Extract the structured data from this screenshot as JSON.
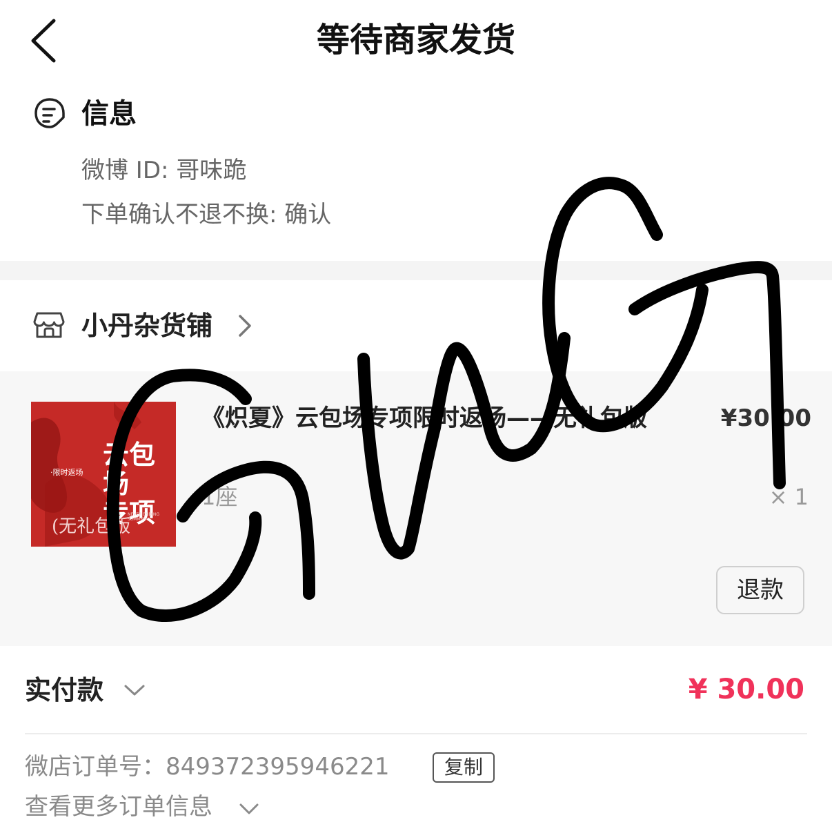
{
  "header": {
    "title": "等待商家发货",
    "back_icon": "chevron-left-icon"
  },
  "info_section": {
    "title": "信息",
    "icon": "message-note-icon",
    "weibo_id_line": "微博 ID: 哥味跪",
    "confirm_line": "下单确认不退不换: 确认"
  },
  "shop": {
    "name": "小丹杂货铺",
    "icon": "storefront-icon",
    "chevron": "chevron-right-icon"
  },
  "product": {
    "title": "《炽夏》云包场专项限时返场——无礼包版",
    "price": "¥30.00",
    "spec": "1座",
    "quantity": "× 1",
    "refund_label": "退款",
    "thumbnail": {
      "main_text": "云包场\n专项",
      "sub_text": "·限时返场",
      "bottom_text": "(无礼包版",
      "tiny_text": "NEVER ENDING SUMMER",
      "background": "#c52a27"
    }
  },
  "payment": {
    "label": "实付款",
    "amount": "¥ 30.00",
    "amount_color": "#f0325a"
  },
  "order": {
    "number_line": "微店订单号：849372395946221",
    "copy_label": "复制",
    "more_label": "查看更多订单信息"
  }
}
